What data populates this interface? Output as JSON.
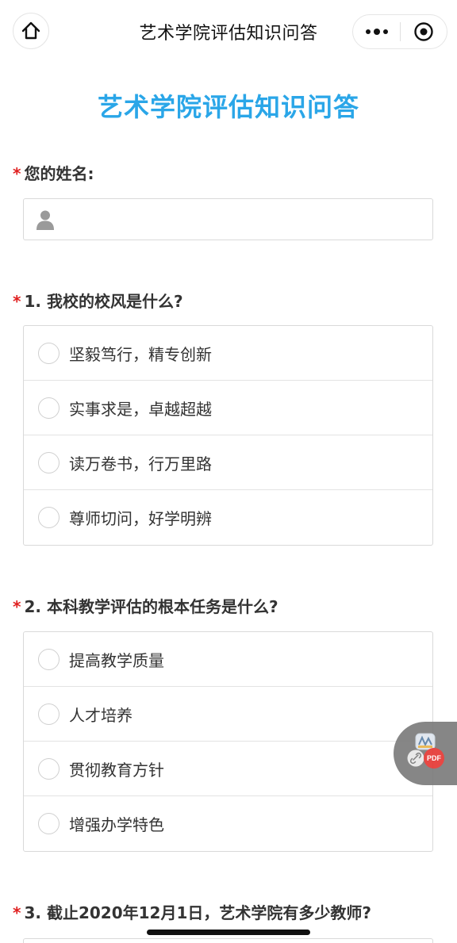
{
  "nav": {
    "title": "艺术学院评估知识问答"
  },
  "form": {
    "title": "艺术学院评估知识问答",
    "required_mark": "*",
    "name_label": "您的姓名:",
    "name_value": ""
  },
  "questions": [
    {
      "label": "1. 我校的校风是什么?",
      "options": [
        "坚毅笃行，精专创新",
        "实事求是，卓越超越",
        "读万卷书，行万里路",
        "尊师切问，好学明辨"
      ]
    },
    {
      "label": "2. 本科教学评估的根本任务是什么?",
      "options": [
        "提高教学质量",
        "人才培养",
        "贯彻教育方针",
        "增强办学特色"
      ]
    },
    {
      "label": "3. 截止2020年12月1日，艺术学院有多少教师?",
      "options": []
    }
  ],
  "floating_tool": {
    "pdf_badge": "PDF",
    "icons": [
      "app-logo-icon",
      "link-icon",
      "pdf-icon"
    ]
  },
  "colors": {
    "title_blue": "#2aa6e8",
    "required_red": "#e02020",
    "border_gray": "#d9d9d9"
  }
}
